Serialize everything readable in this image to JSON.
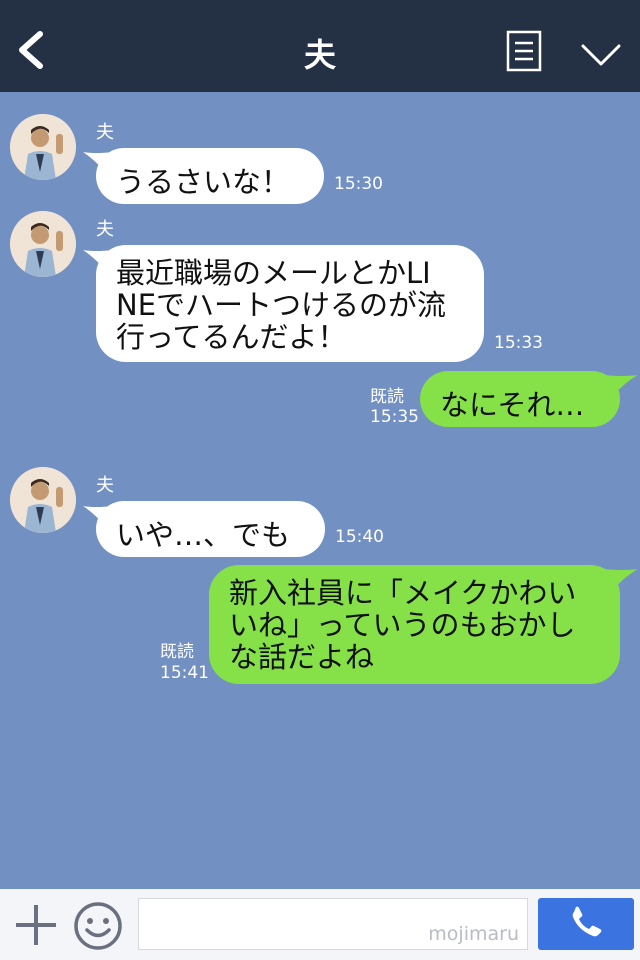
{
  "header": {
    "title": "夫"
  },
  "messages": [
    {
      "side": "in",
      "sender": "夫",
      "text": "うるさいな！",
      "time": "15:30"
    },
    {
      "side": "in",
      "sender": "夫",
      "lines": [
        "最近職場のメールとかLI",
        "NEでハートつけるのが流",
        "行ってるんだよ！"
      ],
      "time": "15:33"
    },
    {
      "side": "out",
      "read": "既読",
      "text": "なにそれ…",
      "time": "15:35"
    },
    {
      "side": "in",
      "sender": "夫",
      "text": "いや…、でも",
      "time": "15:40"
    },
    {
      "side": "out",
      "read": "既読",
      "lines": [
        "新入社員に「メイクかわい",
        "いね」っていうのもおかし",
        "な話だよね"
      ],
      "time": "15:41"
    }
  ],
  "footer": {
    "watermark": "mojimaru"
  },
  "colors": {
    "header": "#243044",
    "chat_bg": "#7290c2",
    "in_bubble": "#ffffff",
    "out_bubble": "#86e048",
    "call": "#3b73e0"
  },
  "icons": [
    "back-chevron-icon",
    "memo-icon",
    "chevron-down-icon",
    "plus-icon",
    "smile-icon",
    "phone-icon"
  ]
}
